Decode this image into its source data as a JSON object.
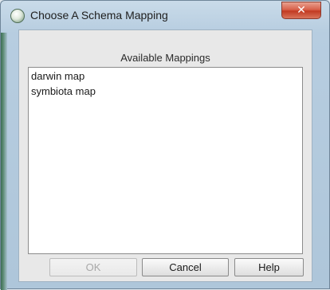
{
  "window": {
    "title": "Choose A Schema Mapping",
    "app_icon": "app-logo-icon",
    "close_icon_glyph": "✕"
  },
  "mappings": {
    "heading": "Available Mappings",
    "items": [
      {
        "label": "darwin map"
      },
      {
        "label": "symbiota map"
      }
    ]
  },
  "buttons": {
    "ok_label": "OK",
    "ok_enabled": false,
    "cancel_label": "Cancel",
    "help_label": "Help"
  },
  "colors": {
    "close_button": "#c23a22",
    "window_frame": "#b7cde0",
    "disabled_text": "#a8a8a8"
  }
}
